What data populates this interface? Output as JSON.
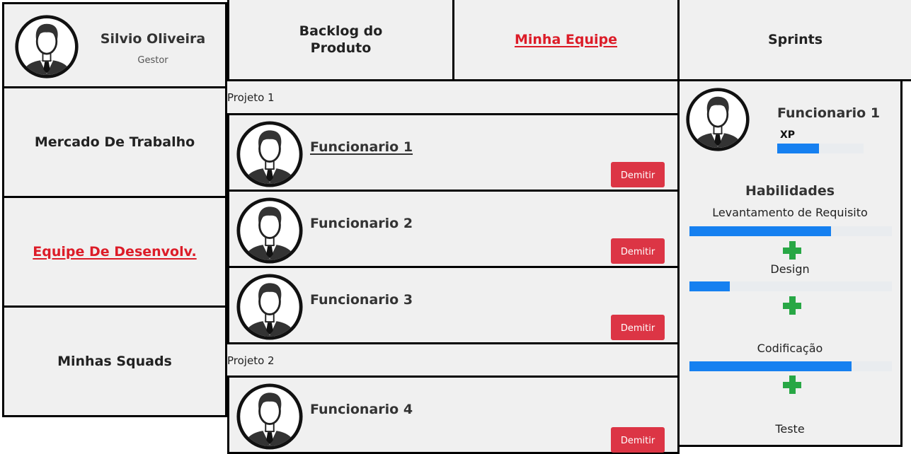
{
  "user": {
    "name": "Silvio Oliveira",
    "role": "Gestor",
    "avatar_icon": "user-avatar-icon"
  },
  "sidebar": {
    "items": [
      {
        "label": "Mercado De Trabalho",
        "active": false
      },
      {
        "label": "Equipe De Desenvolv.",
        "active": true
      },
      {
        "label": "Minhas Squads",
        "active": false
      }
    ]
  },
  "tabs": [
    {
      "label_line1": "Backlog do",
      "label_line2": "Produto",
      "active": false
    },
    {
      "label": "Minha Equipe",
      "active": true
    },
    {
      "label": "Sprints",
      "active": false
    }
  ],
  "projects": [
    {
      "name": "Projeto 1",
      "employees": [
        {
          "name": "Funcionario 1",
          "action": "Demitir",
          "selected": true
        },
        {
          "name": "Funcionario 2",
          "action": "Demitir",
          "selected": false
        },
        {
          "name": "Funcionario 3",
          "action": "Demitir",
          "selected": false
        }
      ]
    },
    {
      "name": "Projeto 2",
      "employees": [
        {
          "name": "Funcionario 4",
          "action": "Demitir",
          "selected": false
        }
      ]
    }
  ],
  "detail": {
    "name": "Funcionario 1",
    "xp_label": "XP",
    "xp_progress": 0.48,
    "skills_title": "Habilidades",
    "skills": [
      {
        "name": "Levantamento de Requisito",
        "progress": 0.7
      },
      {
        "name": "Design",
        "progress": 0.2
      },
      {
        "name": "Codificação",
        "progress": 0.8
      },
      {
        "name": "Teste",
        "progress": 0.0
      }
    ]
  },
  "colors": {
    "accent_red": "#dc1c28",
    "button_red": "#dc3545",
    "progress_blue": "#1680f0",
    "plus_green": "#28a745",
    "panel_bg": "#f0f0f0"
  }
}
